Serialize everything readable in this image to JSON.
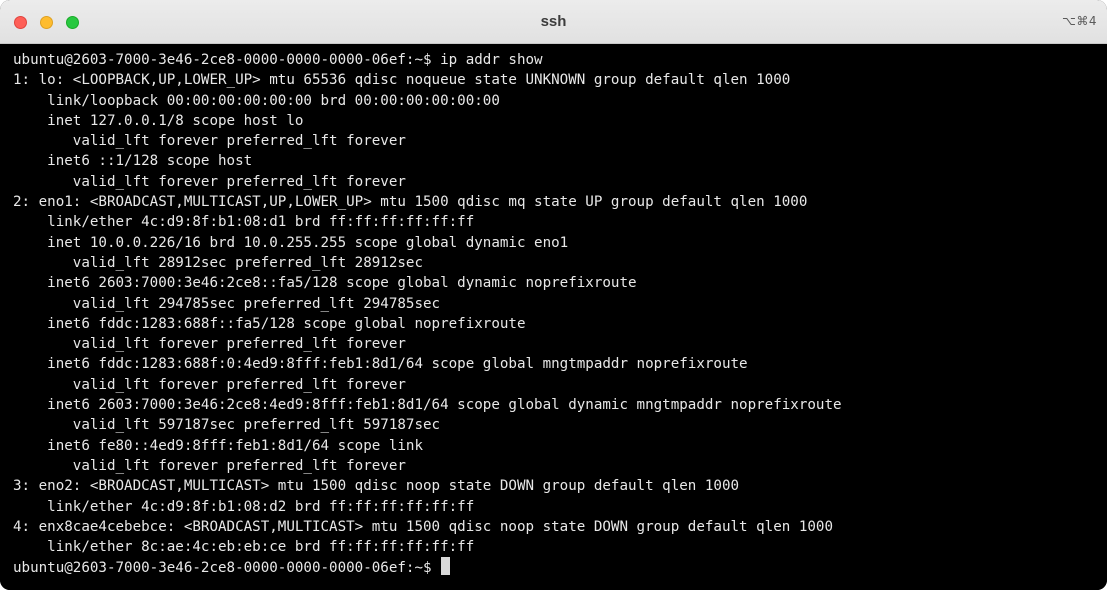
{
  "window": {
    "title": "ssh",
    "shortcut": "⌥⌘4"
  },
  "terminal": {
    "lines": [
      "ubuntu@2603-7000-3e46-2ce8-0000-0000-0000-06ef:~$ ip addr show",
      "1: lo: <LOOPBACK,UP,LOWER_UP> mtu 65536 qdisc noqueue state UNKNOWN group default qlen 1000",
      "    link/loopback 00:00:00:00:00:00 brd 00:00:00:00:00:00",
      "    inet 127.0.0.1/8 scope host lo",
      "       valid_lft forever preferred_lft forever",
      "    inet6 ::1/128 scope host",
      "       valid_lft forever preferred_lft forever",
      "2: eno1: <BROADCAST,MULTICAST,UP,LOWER_UP> mtu 1500 qdisc mq state UP group default qlen 1000",
      "    link/ether 4c:d9:8f:b1:08:d1 brd ff:ff:ff:ff:ff:ff",
      "    inet 10.0.0.226/16 brd 10.0.255.255 scope global dynamic eno1",
      "       valid_lft 28912sec preferred_lft 28912sec",
      "    inet6 2603:7000:3e46:2ce8::fa5/128 scope global dynamic noprefixroute",
      "       valid_lft 294785sec preferred_lft 294785sec",
      "    inet6 fddc:1283:688f::fa5/128 scope global noprefixroute",
      "       valid_lft forever preferred_lft forever",
      "    inet6 fddc:1283:688f:0:4ed9:8fff:feb1:8d1/64 scope global mngtmpaddr noprefixroute",
      "       valid_lft forever preferred_lft forever",
      "    inet6 2603:7000:3e46:2ce8:4ed9:8fff:feb1:8d1/64 scope global dynamic mngtmpaddr noprefixroute",
      "       valid_lft 597187sec preferred_lft 597187sec",
      "    inet6 fe80::4ed9:8fff:feb1:8d1/64 scope link",
      "       valid_lft forever preferred_lft forever",
      "3: eno2: <BROADCAST,MULTICAST> mtu 1500 qdisc noop state DOWN group default qlen 1000",
      "    link/ether 4c:d9:8f:b1:08:d2 brd ff:ff:ff:ff:ff:ff",
      "4: enx8cae4cebebce: <BROADCAST,MULTICAST> mtu 1500 qdisc noop state DOWN group default qlen 1000",
      "    link/ether 8c:ae:4c:eb:eb:ce brd ff:ff:ff:ff:ff:ff"
    ],
    "prompt": "ubuntu@2603-7000-3e46-2ce8-0000-0000-0000-06ef:~$ "
  },
  "colors": {
    "background": "#000000",
    "text": "#e8e8e8",
    "close": "#fe5f57",
    "minimize": "#febc2e",
    "zoom": "#28c840"
  }
}
